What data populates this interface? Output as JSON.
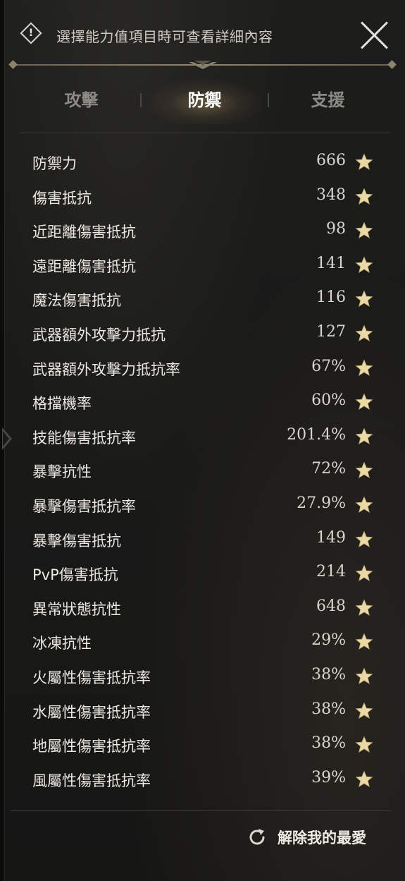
{
  "header": {
    "hint": "選擇能力值項目時可查看詳細內容",
    "info_icon": "exclamation-diamond-icon",
    "close_icon": "close-x-icon"
  },
  "tabs": [
    {
      "label": "攻擊",
      "active": false
    },
    {
      "label": "防禦",
      "active": true
    },
    {
      "label": "支援",
      "active": false
    }
  ],
  "stats": [
    {
      "label": "防禦力",
      "value": "666",
      "favorite": true
    },
    {
      "label": "傷害抵抗",
      "value": "348",
      "favorite": true
    },
    {
      "label": "近距離傷害抵抗",
      "value": "98",
      "favorite": true
    },
    {
      "label": "遠距離傷害抵抗",
      "value": "141",
      "favorite": true
    },
    {
      "label": "魔法傷害抵抗",
      "value": "116",
      "favorite": true
    },
    {
      "label": "武器額外攻擊力抵抗",
      "value": "127",
      "favorite": true
    },
    {
      "label": "武器額外攻擊力抵抗率",
      "value": "67%",
      "favorite": true
    },
    {
      "label": "格擋機率",
      "value": "60%",
      "favorite": true
    },
    {
      "label": "技能傷害抵抗率",
      "value": "201.4%",
      "favorite": true
    },
    {
      "label": "暴擊抗性",
      "value": "72%",
      "favorite": true
    },
    {
      "label": "暴擊傷害抵抗率",
      "value": "27.9%",
      "favorite": true
    },
    {
      "label": "暴擊傷害抵抗",
      "value": "149",
      "favorite": true
    },
    {
      "label": "PvP傷害抵抗",
      "value": "214",
      "favorite": true
    },
    {
      "label": "異常狀態抗性",
      "value": "648",
      "favorite": true
    },
    {
      "label": "冰凍抗性",
      "value": "29%",
      "favorite": true
    },
    {
      "label": "火屬性傷害抵抗率",
      "value": "38%",
      "favorite": true
    },
    {
      "label": "水屬性傷害抵抗率",
      "value": "38%",
      "favorite": true
    },
    {
      "label": "地屬性傷害抵抗率",
      "value": "38%",
      "favorite": true
    },
    {
      "label": "風屬性傷害抵抗率",
      "value": "39%",
      "favorite": true
    }
  ],
  "footer": {
    "unfavorite_label": "解除我的最愛",
    "refresh_icon": "refresh-icon"
  },
  "colors": {
    "star": "#e9d9a6",
    "active_tab_glow": "#968054",
    "panel_bg": "#1b1b1a"
  }
}
